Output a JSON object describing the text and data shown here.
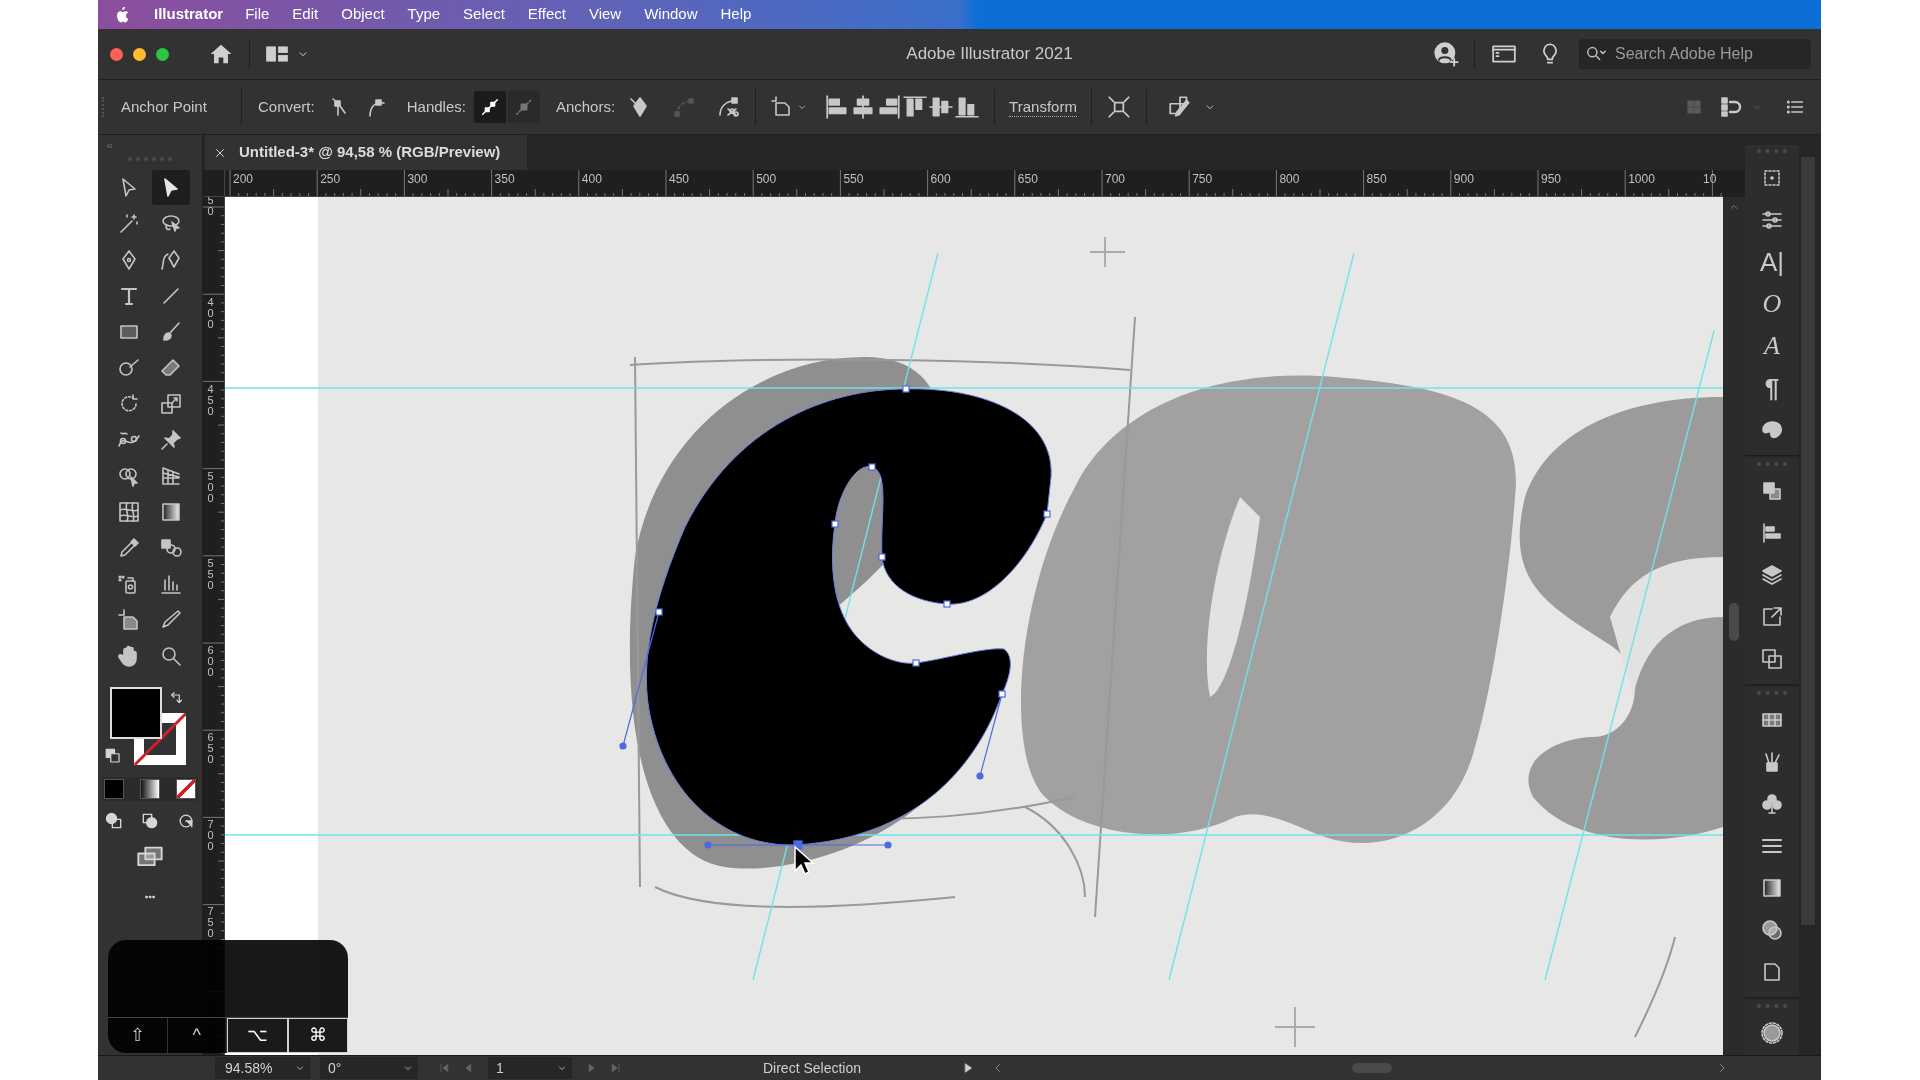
{
  "menu_bar": {
    "items": [
      {
        "label": "Illustrator",
        "kind": "app"
      },
      {
        "label": "File",
        "kind": "menu"
      },
      {
        "label": "Edit",
        "kind": "menu"
      },
      {
        "label": "Object",
        "kind": "menu"
      },
      {
        "label": "Type",
        "kind": "menu"
      },
      {
        "label": "Select",
        "kind": "menu"
      },
      {
        "label": "Effect",
        "kind": "menu"
      },
      {
        "label": "View",
        "kind": "menu"
      },
      {
        "label": "Window",
        "kind": "menu"
      },
      {
        "label": "Help",
        "kind": "menu"
      }
    ]
  },
  "title_bar": {
    "title": "Adobe Illustrator 2021",
    "search": {
      "placeholder": "Search Adobe Help"
    }
  },
  "control_bar": {
    "selection_label": "Anchor Point",
    "convert_label": "Convert:",
    "handles_label": "Handles:",
    "handles": [
      {
        "selected": true
      },
      {
        "selected": false
      }
    ],
    "anchors_label": "Anchors:",
    "anchors": [
      {
        "disabled": false
      },
      {
        "disabled": true
      },
      {
        "disabled": false
      }
    ],
    "transform_link": "Transform"
  },
  "document_tab": {
    "title": "Untitled-3* @ 94,58 % (RGB/Preview)"
  },
  "rulers": {
    "horizontal": [
      "200",
      "250",
      "300",
      "350",
      "400",
      "450",
      "500",
      "550",
      "600",
      "650",
      "700",
      "750",
      "800",
      "850",
      "900",
      "950",
      "1000",
      "10"
    ],
    "vertical": [
      "50",
      "400",
      "450",
      "500",
      "550",
      "600",
      "650",
      "700",
      "750"
    ]
  },
  "tools": [
    {
      "kind": "selection",
      "selected": false
    },
    {
      "kind": "direct-selection",
      "selected": true
    },
    {
      "kind": "magic-wand",
      "selected": false
    },
    {
      "kind": "lasso",
      "selected": false
    },
    {
      "kind": "pen",
      "selected": false
    },
    {
      "kind": "curvature",
      "selected": false
    },
    {
      "kind": "type",
      "selected": false
    },
    {
      "kind": "line",
      "selected": false
    },
    {
      "kind": "rectangle",
      "selected": false
    },
    {
      "kind": "paintbrush",
      "selected": false
    },
    {
      "kind": "shaper",
      "selected": false
    },
    {
      "kind": "eraser",
      "selected": false
    },
    {
      "kind": "rotate",
      "selected": false
    },
    {
      "kind": "scale",
      "selected": false
    },
    {
      "kind": "warp",
      "selected": false
    },
    {
      "kind": "pin",
      "selected": false
    },
    {
      "kind": "shape-builder",
      "selected": false
    },
    {
      "kind": "perspective",
      "selected": false
    },
    {
      "kind": "mesh",
      "selected": false
    },
    {
      "kind": "gradient",
      "selected": false
    },
    {
      "kind": "eyedropper",
      "selected": false
    },
    {
      "kind": "blend",
      "selected": false
    },
    {
      "kind": "symbol-sprayer",
      "selected": false
    },
    {
      "kind": "graph",
      "selected": false
    },
    {
      "kind": "artboard",
      "selected": false
    },
    {
      "kind": "knife",
      "selected": false
    },
    {
      "kind": "hand",
      "selected": false
    },
    {
      "kind": "zoom",
      "selected": false
    }
  ],
  "right_panel": {
    "groups": [
      [
        {
          "kind": "artboards"
        },
        {
          "kind": "properties"
        },
        {
          "kind": "character",
          "glyph": "A|"
        },
        {
          "kind": "opentype",
          "glyph": "O"
        },
        {
          "kind": "glyphs",
          "glyph": "A"
        },
        {
          "kind": "paragraph",
          "glyph": "¶"
        },
        {
          "kind": "palette"
        }
      ],
      [
        {
          "kind": "pathfinder"
        },
        {
          "kind": "align"
        },
        {
          "kind": "layers"
        },
        {
          "kind": "export"
        },
        {
          "kind": "transform"
        }
      ],
      [
        {
          "kind": "swatches"
        },
        {
          "kind": "brushes"
        },
        {
          "kind": "symbols"
        },
        {
          "kind": "stroke"
        },
        {
          "kind": "gradient"
        },
        {
          "kind": "transparency"
        },
        {
          "kind": "document"
        }
      ],
      [
        {
          "kind": "appearance"
        }
      ]
    ]
  },
  "status_bar": {
    "zoom": "94.58%",
    "rotation": "0°",
    "artboard": "1",
    "tool": "Direct Selection"
  },
  "key_overlay": {
    "keys": [
      {
        "key": "⇧",
        "pressed": false
      },
      {
        "key": "^",
        "pressed": false
      },
      {
        "key": "⌥",
        "pressed": true
      },
      {
        "key": "⌘",
        "pressed": true
      }
    ]
  }
}
